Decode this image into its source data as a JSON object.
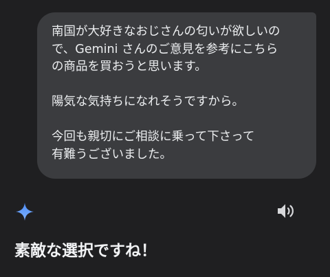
{
  "user_message": {
    "lines": [
      "南国が大好きなおじさんの匂いが欲しいの",
      "で、Gemini さんのご意見を参考にこちら",
      "の商品を買おうと思います。",
      "",
      "陽気な気持ちになれそうですから。",
      "",
      "今回も親切にご相談に乗って下さって",
      "有難うございました。"
    ]
  },
  "assistant": {
    "icon": "gemini-sparkle-icon",
    "read_aloud_icon": "speaker-icon",
    "reply_text": "素敵な選択ですね！"
  },
  "colors": {
    "background": "#1f1f21",
    "bubble": "#3b3c3f",
    "text": "#eceef0",
    "sparkle_top": "#4d8cf5",
    "sparkle_bottom": "#7fb2ff"
  }
}
